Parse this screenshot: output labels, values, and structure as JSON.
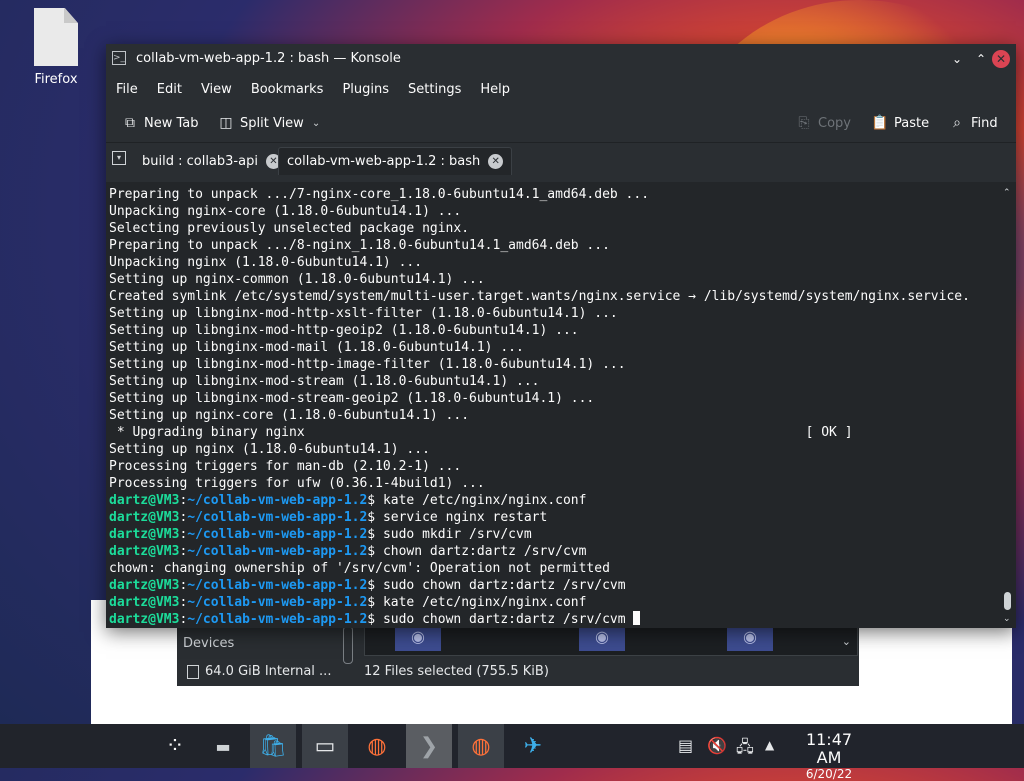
{
  "desktop": {
    "icon_label": "Firefox"
  },
  "konsole": {
    "title": "collab-vm-web-app-1.2 : bash — Konsole",
    "menu": [
      "File",
      "Edit",
      "View",
      "Bookmarks",
      "Plugins",
      "Settings",
      "Help"
    ],
    "toolbar": {
      "new_tab": "New Tab",
      "split_view": "Split View",
      "copy": "Copy",
      "paste": "Paste",
      "find": "Find"
    },
    "tabs": [
      {
        "label": "build : collab3-api",
        "active": false
      },
      {
        "label": "collab-vm-web-app-1.2 : bash",
        "active": true
      }
    ],
    "output_lines": [
      "Preparing to unpack .../7-nginx-core_1.18.0-6ubuntu14.1_amd64.deb ...",
      "Unpacking nginx-core (1.18.0-6ubuntu14.1) ...",
      "Selecting previously unselected package nginx.",
      "Preparing to unpack .../8-nginx_1.18.0-6ubuntu14.1_amd64.deb ...",
      "Unpacking nginx (1.18.0-6ubuntu14.1) ...",
      "Setting up nginx-common (1.18.0-6ubuntu14.1) ...",
      "Created symlink /etc/systemd/system/multi-user.target.wants/nginx.service → /lib/systemd/system/nginx.service.",
      "Setting up libnginx-mod-http-xslt-filter (1.18.0-6ubuntu14.1) ...",
      "Setting up libnginx-mod-http-geoip2 (1.18.0-6ubuntu14.1) ...",
      "Setting up libnginx-mod-mail (1.18.0-6ubuntu14.1) ...",
      "Setting up libnginx-mod-http-image-filter (1.18.0-6ubuntu14.1) ...",
      "Setting up libnginx-mod-stream (1.18.0-6ubuntu14.1) ...",
      "Setting up libnginx-mod-stream-geoip2 (1.18.0-6ubuntu14.1) ...",
      "Setting up nginx-core (1.18.0-6ubuntu14.1) ...",
      " * Upgrading binary nginx                                                                [ OK ]",
      "Setting up nginx (1.18.0-6ubuntu14.1) ...",
      "Processing triggers for man-db (2.10.2-1) ...",
      "Processing triggers for ufw (0.36.1-4build1) ..."
    ],
    "prompt": {
      "user": "dartz@VM3",
      "path": "~/collab-vm-web-app-1.2"
    },
    "session": [
      {
        "type": "cmd",
        "text": "kate /etc/nginx/nginx.conf"
      },
      {
        "type": "cmd",
        "text": "service nginx restart"
      },
      {
        "type": "cmd",
        "text": "sudo mkdir /srv/cvm"
      },
      {
        "type": "cmd",
        "text": "chown dartz:dartz /srv/cvm"
      },
      {
        "type": "out",
        "text": "chown: changing ownership of '/srv/cvm': Operation not permitted"
      },
      {
        "type": "cmd",
        "text": "sudo chown dartz:dartz /srv/cvm"
      },
      {
        "type": "cmd",
        "text": "kate /etc/nginx/nginx.conf"
      },
      {
        "type": "cmd",
        "text": "sudo chown dartz:dartz /srv/cvm",
        "current": true
      }
    ]
  },
  "file_manager": {
    "devices_label": "Devices",
    "drive_label": "64.0 GiB Internal ...",
    "status": "12 Files selected (755.5 KiB)"
  },
  "taskbar": {
    "time": "11:47 AM",
    "date": "6/20/22",
    "items": [
      "app-launcher-icon",
      "system-settings-icon",
      "discover-store-icon",
      "dolphin-files-icon",
      "firefox-icon",
      "konsole-icon",
      "firefox-icon",
      "remote-desktop-icon"
    ]
  }
}
